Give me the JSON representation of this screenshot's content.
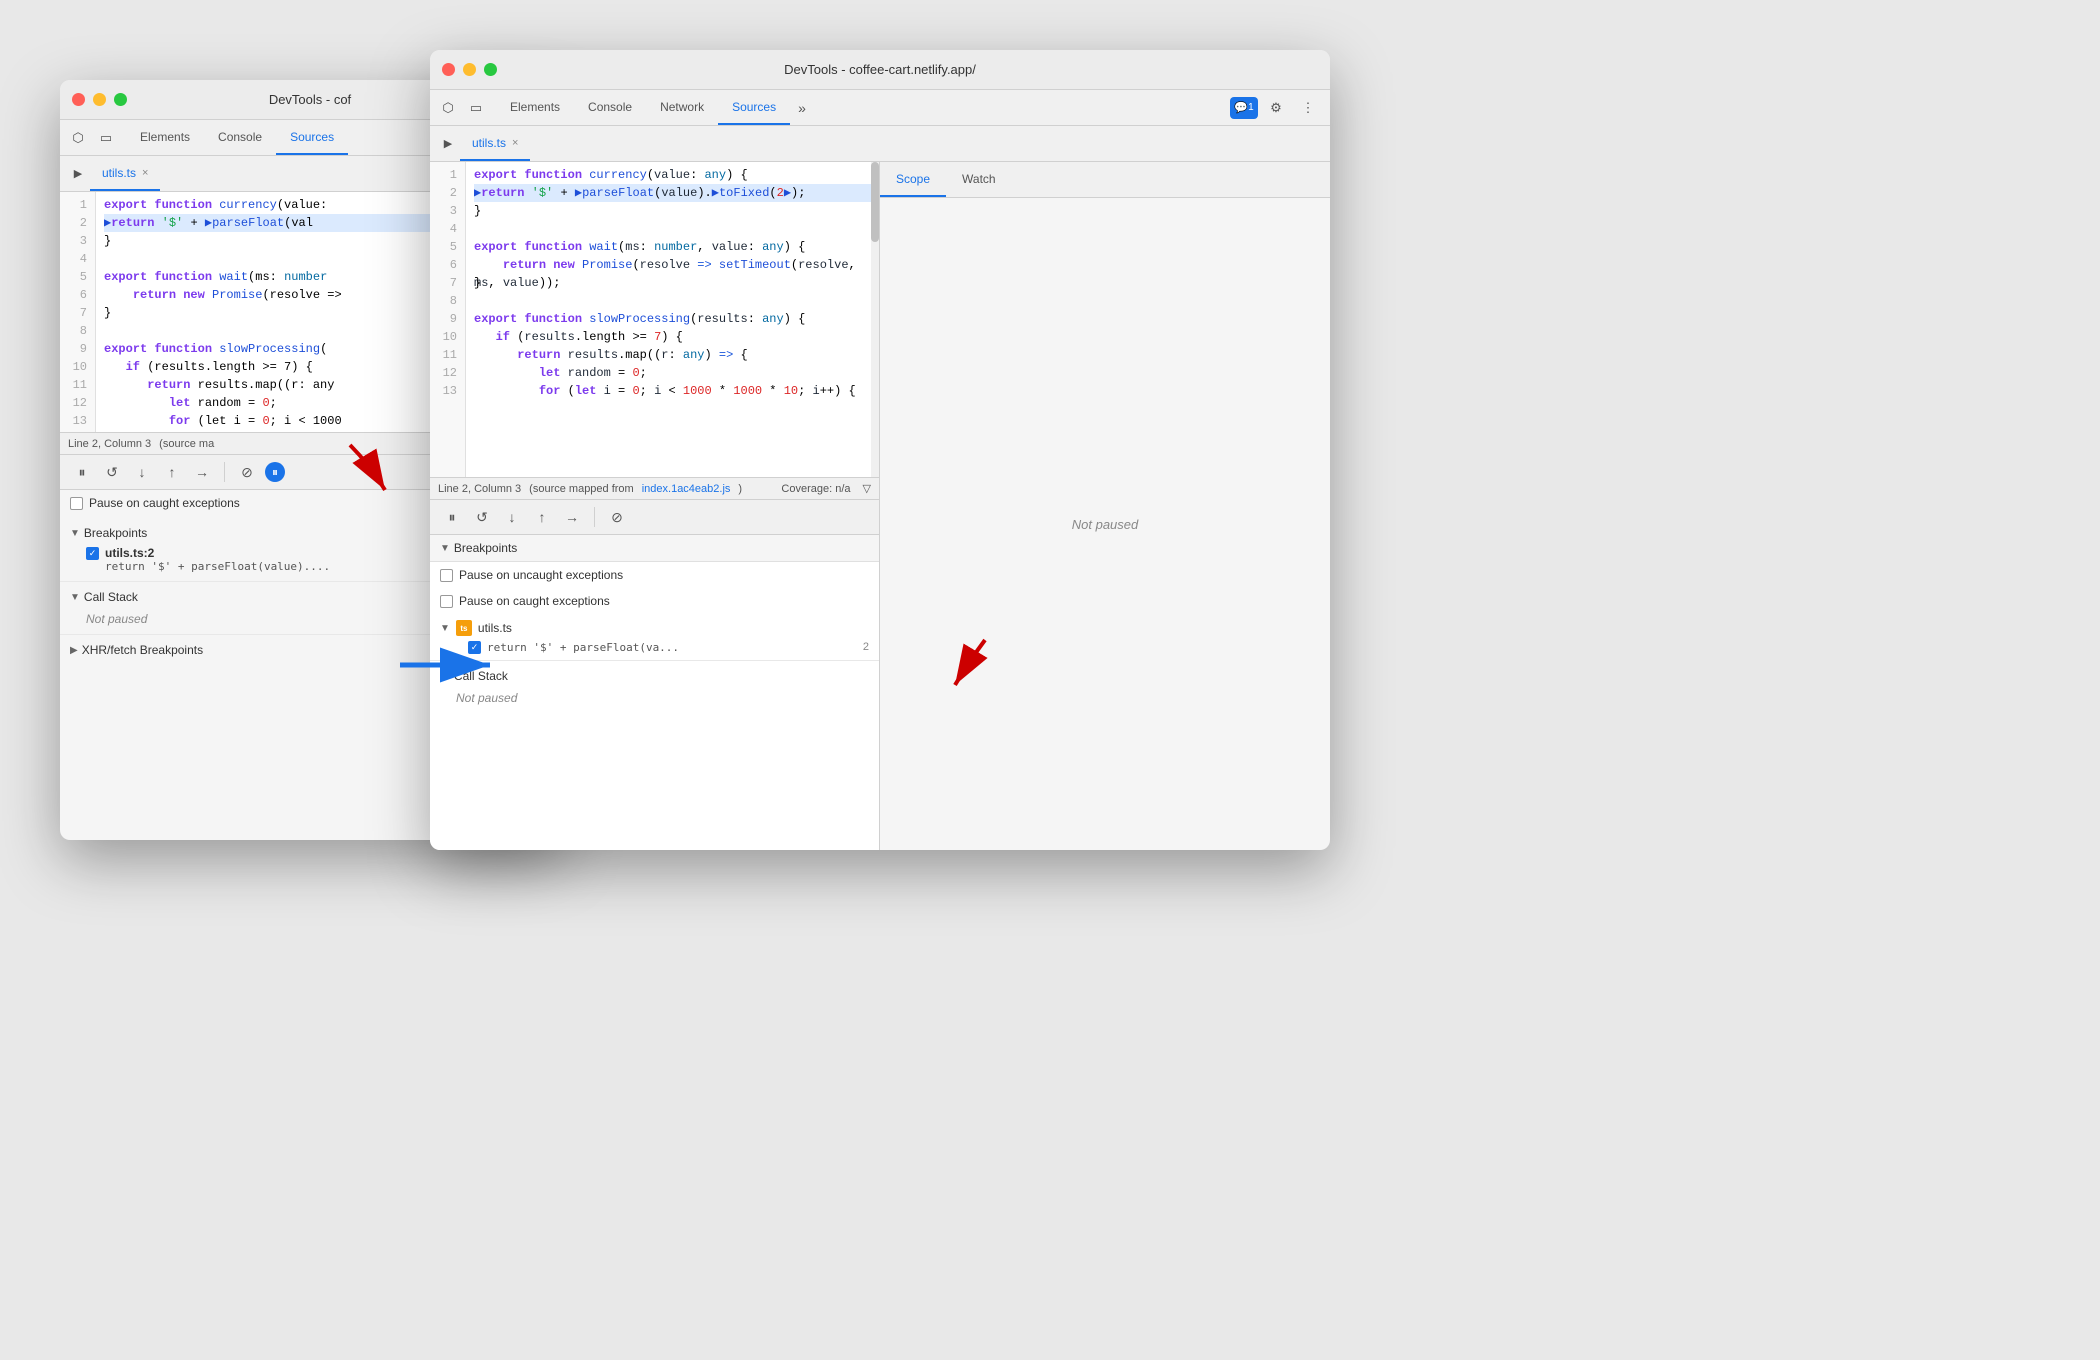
{
  "bg_window": {
    "title": "DevTools - cof",
    "tabs": [
      "Elements",
      "Console",
      "Sources"
    ],
    "active_tab": "Sources",
    "file_tab": "utils.ts",
    "lines": [
      {
        "num": 1,
        "code": "export function currency(value: "
      },
      {
        "num": 2,
        "code": "  ▶return '$' + ▶parseFloat(val",
        "highlight": true
      },
      {
        "num": 3,
        "code": "}"
      },
      {
        "num": 4,
        "code": ""
      },
      {
        "num": 5,
        "code": "export function wait(ms: number"
      },
      {
        "num": 6,
        "code": "    return new Promise(resolve =>"
      },
      {
        "num": 7,
        "code": "}"
      },
      {
        "num": 8,
        "code": ""
      },
      {
        "num": 9,
        "code": "export function slowProcessing("
      },
      {
        "num": 10,
        "code": "   if (results.length >= 7) {"
      },
      {
        "num": 11,
        "code": "      return results.map((r: any"
      },
      {
        "num": 12,
        "code": "         let random = 0;"
      },
      {
        "num": 13,
        "code": "         for (let i = 0; i < 1000"
      }
    ],
    "status": "Line 2, Column 3",
    "status_right": "(source ma",
    "debug_controls": [
      "pause",
      "resume",
      "step-over",
      "step-into",
      "step-out",
      "deactivate"
    ],
    "pause_caught": "Pause on caught exceptions",
    "breakpoints_header": "Breakpoints",
    "bp_file": "utils.ts:2",
    "bp_code": "return '$' + parseFloat(value)....",
    "call_stack_header": "Call Stack",
    "not_paused": "Not paused",
    "xhr_header": "XHR/fetch Breakpoints"
  },
  "front_window": {
    "title": "DevTools - coffee-cart.netlify.app/",
    "tabs": [
      "Elements",
      "Console",
      "Network",
      "Sources"
    ],
    "active_tab": "Sources",
    "file_tab": "utils.ts",
    "lines": [
      {
        "num": 1,
        "code": "export function currency(value: any) {"
      },
      {
        "num": 2,
        "code": "  ▶return '$' + ▶parseFloat(value).▶toFixed(2▶);",
        "highlight": true
      },
      {
        "num": 3,
        "code": "}"
      },
      {
        "num": 4,
        "code": ""
      },
      {
        "num": 5,
        "code": "export function wait(ms: number, value: any) {"
      },
      {
        "num": 6,
        "code": "    return new Promise(resolve => setTimeout(resolve, ms, value));"
      },
      {
        "num": 7,
        "code": "}"
      },
      {
        "num": 8,
        "code": ""
      },
      {
        "num": 9,
        "code": "export function slowProcessing(results: any) {"
      },
      {
        "num": 10,
        "code": "   if (results.length >= 7) {"
      },
      {
        "num": 11,
        "code": "      return results.map((r: any) => {"
      },
      {
        "num": 12,
        "code": "         let random = 0;"
      },
      {
        "num": 13,
        "code": "         for (let i = 0; i < 1000 * 1000 * 10; i++) {"
      }
    ],
    "status": "Line 2, Column 3",
    "status_right": "(source mapped from ",
    "source_link": "index.1ac4eab2.js",
    "coverage": "Coverage: n/a",
    "breakpoints_header": "Breakpoints",
    "pause_uncaught": "Pause on uncaught exceptions",
    "pause_caught": "Pause on caught exceptions",
    "utils_file": "utils.ts",
    "bp_code": "return '$' + parseFloat(va...",
    "bp_line": "2",
    "call_stack_header": "Call Stack",
    "not_paused": "Not paused",
    "scope_tab": "Scope",
    "watch_tab": "Watch",
    "scope_not_paused": "Not paused",
    "comment_badge": "1",
    "toolbar_icons": [
      "cursor",
      "device",
      "inspect"
    ]
  },
  "arrows": {
    "red1": "pointing to pause button",
    "red2": "pointing to breakpoints panel",
    "blue": "pointing to breakpoints section"
  }
}
